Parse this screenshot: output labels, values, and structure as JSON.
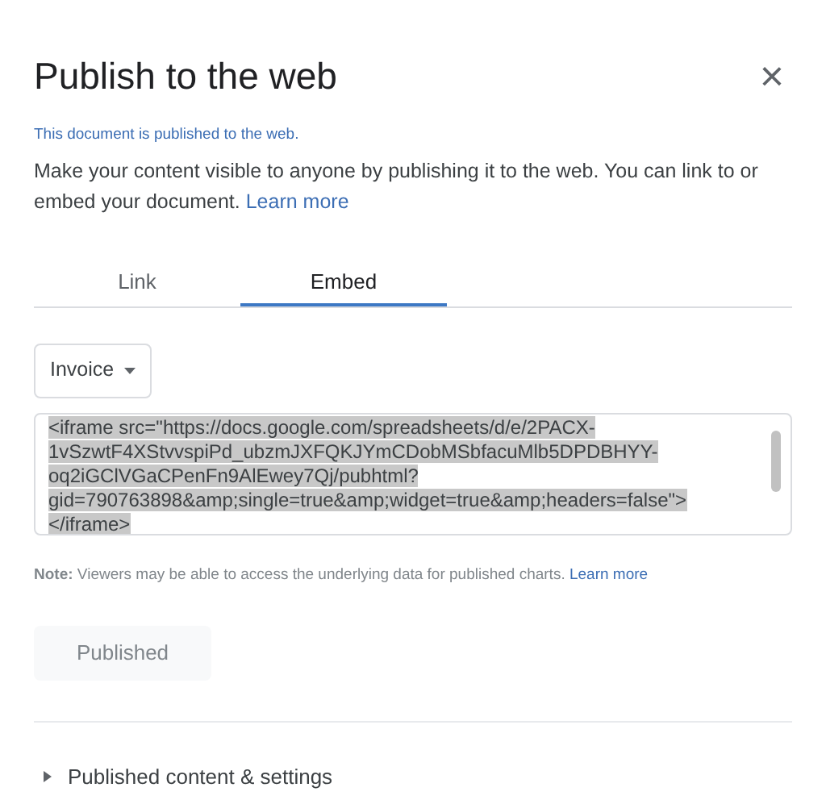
{
  "dialog": {
    "title": "Publish to the web",
    "close": "×"
  },
  "status": "This document is published to the web.",
  "description": {
    "text": "Make your content visible to anyone by publishing it to the web. You can link to or embed your document.",
    "link": "Learn more"
  },
  "tabs": [
    {
      "label": "Link",
      "selected": false
    },
    {
      "label": "Embed",
      "selected": true
    }
  ],
  "sheet_dropdown": {
    "value": "Invoice"
  },
  "embed_code": {
    "selected": true,
    "lines": [
      "<iframe src=\"https://docs.google.com/spreadsheets/d/e/2PACX-",
      "1vSzwtF4XStvvspiPd_ubzmJXFQKJYmCDobMSbfacuMlb5DPDBHYY-",
      "oq2iGClVGaCPenFn9AlEwey7Qj/pubhtml?",
      "gid=790763898&amp;single=true&amp;widget=true&amp;headers=false\">",
      "</iframe>"
    ]
  },
  "note": {
    "text": "**Note:** Viewers may be able to access the underlying data for published charts.",
    "link": "Learn more"
  },
  "publish_button": {
    "label": "Published",
    "disabled": true
  },
  "settings_section": {
    "label": "Published content & settings",
    "expanded": false
  }
}
